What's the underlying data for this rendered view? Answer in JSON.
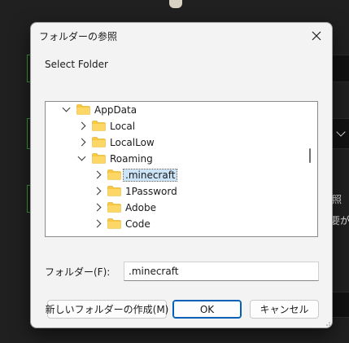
{
  "background": {
    "partial_text_1": "照",
    "partial_text_2": "要が"
  },
  "dialog": {
    "title": "フォルダーの参照",
    "description": "Select Folder",
    "tree": [
      {
        "label": "AppData",
        "depth": 0,
        "state": "expanded"
      },
      {
        "label": "Local",
        "depth": 1,
        "state": "collapsed"
      },
      {
        "label": "LocalLow",
        "depth": 1,
        "state": "collapsed"
      },
      {
        "label": "Roaming",
        "depth": 1,
        "state": "expanded"
      },
      {
        "label": ".minecraft",
        "depth": 2,
        "state": "collapsed",
        "selected": true
      },
      {
        "label": "1Password",
        "depth": 2,
        "state": "collapsed"
      },
      {
        "label": "Adobe",
        "depth": 2,
        "state": "collapsed"
      },
      {
        "label": "Code",
        "depth": 2,
        "state": "collapsed"
      }
    ],
    "folder_field": {
      "label": "フォルダー(F):",
      "value": ".minecraft"
    },
    "buttons": {
      "new_folder": "新しいフォルダーの作成(M)",
      "ok": "OK",
      "cancel": "キャンセル"
    }
  },
  "colors": {
    "folder_yellow": "#f8c93e",
    "selection": "#cce4f7",
    "accent": "#005fb8",
    "bg_field_border": "#3a9a3a"
  },
  "icons": {
    "close": "close-icon",
    "folder": "folder-icon",
    "expand": "chevron-right-icon",
    "collapse": "chevron-down-icon"
  }
}
